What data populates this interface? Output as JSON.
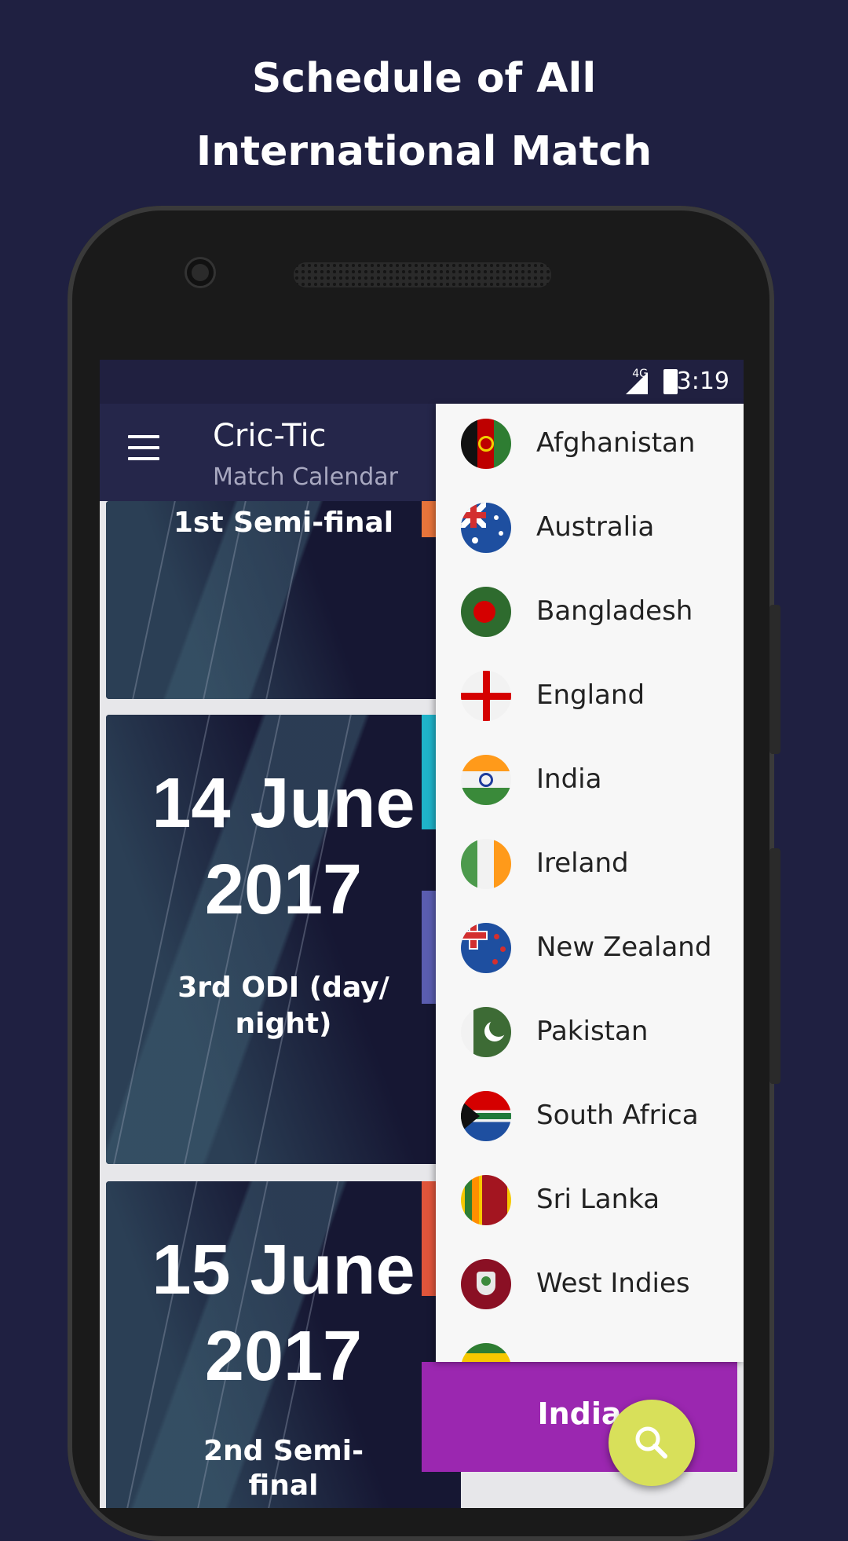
{
  "promo": {
    "line1": "Schedule of All",
    "line2": "International Match"
  },
  "status_bar": {
    "network": "4G",
    "time": "3:19"
  },
  "toolbar": {
    "title": "Cric-Tic",
    "subtitle": "Match Calendar",
    "menu_icon": "hamburger-menu-icon"
  },
  "cards": [
    {
      "date_line1": "",
      "date_line2": "",
      "label": "1st Semi-final"
    },
    {
      "date_line1": "14 June",
      "date_line2": "2017",
      "label_line1": "3rd ODI (day/",
      "label_line2": "night)"
    },
    {
      "date_line1": "15 June",
      "date_line2": "2017",
      "label_line1": "2nd Semi-",
      "label_line2": "final"
    }
  ],
  "team_dropdown": {
    "items": [
      "Afghanistan",
      "Australia",
      "Bangladesh",
      "England",
      "India",
      "Ireland",
      "New Zealand",
      "Pakistan",
      "South Africa",
      "Sri Lanka",
      "West Indies"
    ]
  },
  "selected_team": "India",
  "fab_icon": "search-icon",
  "colors": {
    "background": "#1f2041",
    "toolbar": "#25264a",
    "selected_bar": "#9b27b0",
    "fab": "#d8e05a"
  }
}
